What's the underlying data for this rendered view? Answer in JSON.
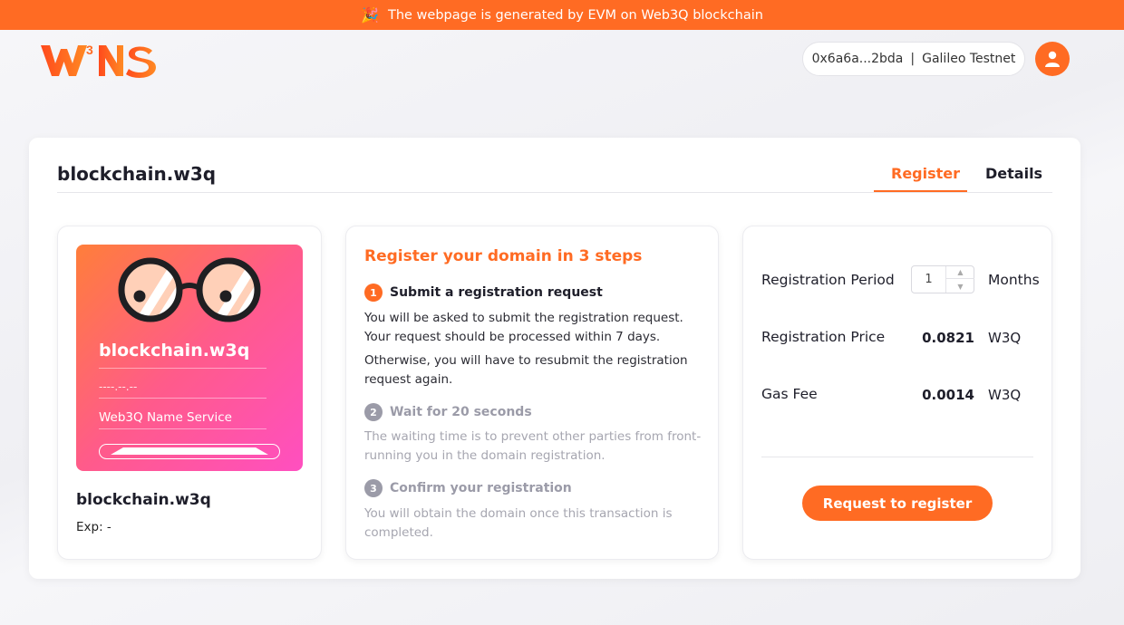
{
  "banner": {
    "icon": "party-popper-icon",
    "text": "The webpage is generated by EVM on Web3Q blockchain"
  },
  "header": {
    "logo_text": "W3NS",
    "wallet_address": "0x6a6a...2bda",
    "wallet_separator": "|",
    "network": "Galileo Testnet",
    "avatar_icon": "user-icon"
  },
  "card": {
    "domain": "blockchain.w3q",
    "tabs": [
      {
        "label": "Register",
        "active": true
      },
      {
        "label": "Details",
        "active": false
      }
    ]
  },
  "nft": {
    "name": "blockchain.w3q",
    "date": "----.--.--",
    "service": "Web3Q Name Service",
    "caption": "blockchain.w3q",
    "exp_label": "Exp: -"
  },
  "steps": {
    "title": "Register your domain in 3 steps",
    "items": [
      {
        "num": "1",
        "title": "Submit a registration request",
        "para1": "You will be asked to submit the registration request. Your request should be processed within 7 days.",
        "para2": "Otherwise, you will have to resubmit the registration request again."
      },
      {
        "num": "2",
        "title": "Wait for 20 seconds",
        "para1": "The waiting time is to prevent other parties from front-running you in the domain registration."
      },
      {
        "num": "3",
        "title": "Confirm your registration",
        "para1": "You will obtain the domain once this transaction is completed."
      }
    ]
  },
  "registration": {
    "period_label": "Registration Period",
    "period_value": "1",
    "period_unit": "Months",
    "price_label": "Registration Price",
    "price_value": "0.0821",
    "price_unit": "W3Q",
    "gas_label": "Gas Fee",
    "gas_value": "0.0014",
    "gas_unit": "W3Q",
    "button_label": "Request to register"
  },
  "colors": {
    "accent": "#ff6b23",
    "muted": "#9b9ba8"
  }
}
